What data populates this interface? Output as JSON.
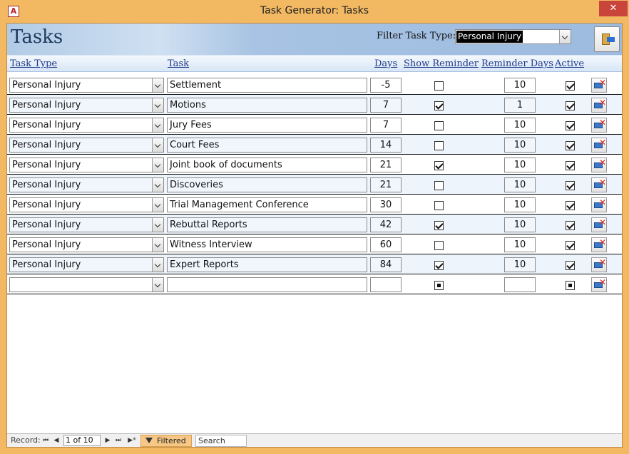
{
  "window": {
    "title": "Task Generator: Tasks",
    "app_icon": "A",
    "close_label": "✕"
  },
  "form": {
    "title": "Tasks",
    "filter_label": "Filter Task Type:",
    "filter_value": "Personal Injury"
  },
  "columns": {
    "task_type": "Task Type",
    "task": "Task",
    "days": "Days",
    "show_reminder": "Show Reminder",
    "reminder_days": "Reminder Days",
    "active": "Active"
  },
  "rows": [
    {
      "type": "Personal Injury",
      "task": "Settlement",
      "days": "-5",
      "show_reminder": false,
      "reminder_days": "10",
      "active": true
    },
    {
      "type": "Personal Injury",
      "task": "Motions",
      "days": "7",
      "show_reminder": true,
      "reminder_days": "1",
      "active": true
    },
    {
      "type": "Personal Injury",
      "task": "Jury Fees",
      "days": "7",
      "show_reminder": false,
      "reminder_days": "10",
      "active": true
    },
    {
      "type": "Personal Injury",
      "task": "Court Fees",
      "days": "14",
      "show_reminder": false,
      "reminder_days": "10",
      "active": true
    },
    {
      "type": "Personal Injury",
      "task": "Joint book of documents",
      "days": "21",
      "show_reminder": true,
      "reminder_days": "10",
      "active": true
    },
    {
      "type": "Personal Injury",
      "task": "Discoveries",
      "days": "21",
      "show_reminder": false,
      "reminder_days": "10",
      "active": true
    },
    {
      "type": "Personal Injury",
      "task": "Trial Management Conference",
      "days": "30",
      "show_reminder": false,
      "reminder_days": "10",
      "active": true
    },
    {
      "type": "Personal Injury",
      "task": "Rebuttal Reports",
      "days": "42",
      "show_reminder": true,
      "reminder_days": "10",
      "active": true
    },
    {
      "type": "Personal Injury",
      "task": "Witness Interview",
      "days": "60",
      "show_reminder": false,
      "reminder_days": "10",
      "active": true
    },
    {
      "type": "Personal Injury",
      "task": "Expert Reports",
      "days": "84",
      "show_reminder": true,
      "reminder_days": "10",
      "active": true
    }
  ],
  "new_row": {
    "type": "",
    "task": "",
    "days": "",
    "reminder_days": ""
  },
  "navigation": {
    "record_label": "Record:",
    "first": "⏮",
    "prev": "◀",
    "position": "1 of 10",
    "next": "▶",
    "last": "⏭",
    "new": "▶*",
    "filtered_label": "Filtered",
    "search_label": "Search"
  },
  "icons": {
    "close_form": "exit-door-icon",
    "delete": "delete-record-icon",
    "filter": "filter-funnel-icon"
  }
}
